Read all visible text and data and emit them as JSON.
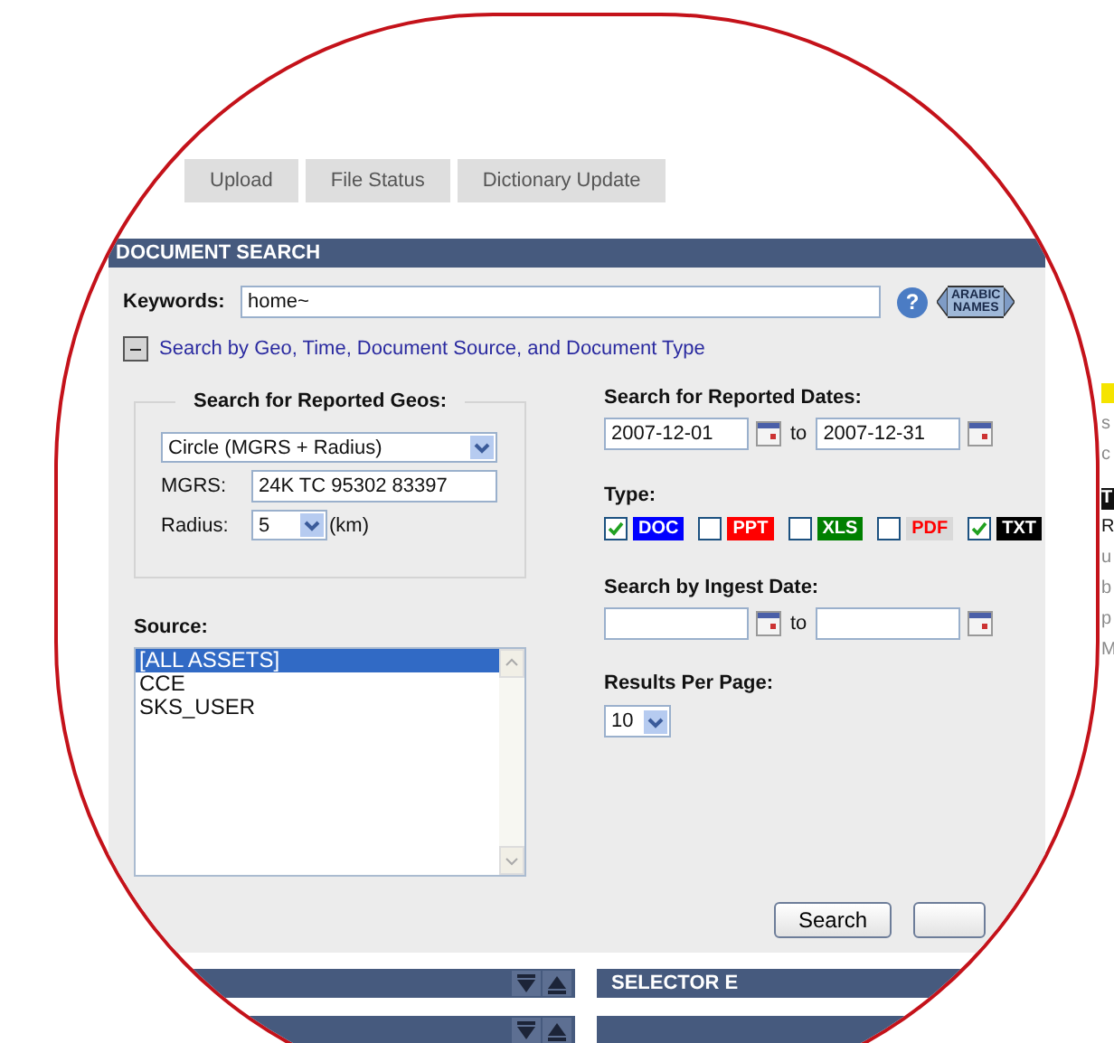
{
  "tabs": [
    {
      "label": "Upload"
    },
    {
      "label": "File Status"
    },
    {
      "label": "Dictionary Update"
    }
  ],
  "section_title": "DOCUMENT SEARCH",
  "keywords": {
    "label": "Keywords:",
    "value": "home~",
    "help_symbol": "?"
  },
  "arabic_names_button": {
    "line_1": "ARABIC",
    "line_2": "NAMES"
  },
  "criteria_toggle": {
    "expanded": true,
    "link": "Search by Geo, Time, Document Source, and Document Type"
  },
  "geo": {
    "legend": "Search for Reported Geos:",
    "shape": "Circle (MGRS + Radius)",
    "mgrs_label": "MGRS:",
    "mgrs": "24K TC 95302 83397",
    "radius_label": "Radius:",
    "radius": "5",
    "unit": "(km)"
  },
  "source": {
    "label": "Source:",
    "items": [
      {
        "label": "[ALL ASSETS]",
        "selected": true
      },
      {
        "label": "CCE",
        "selected": false
      },
      {
        "label": "SKS_USER",
        "selected": false
      }
    ]
  },
  "reported_dates": {
    "label": "Search for Reported Dates:",
    "from": "2007-12-01",
    "to_label": "to",
    "to": "2007-12-31"
  },
  "type": {
    "label": "Type:",
    "options": [
      {
        "label": "DOC",
        "checked": true,
        "kind": "solid",
        "color": "#0000ff"
      },
      {
        "label": "PPT",
        "checked": false,
        "kind": "solid",
        "color": "#ff0000"
      },
      {
        "label": "XLS",
        "checked": false,
        "kind": "solid",
        "color": "#008000"
      },
      {
        "label": "PDF",
        "checked": false,
        "kind": "light",
        "color": "#ff0000"
      },
      {
        "label": "TXT",
        "checked": true,
        "kind": "solid",
        "color": "#000000"
      }
    ]
  },
  "ingest_date": {
    "label": "Search by Ingest Date:",
    "to_label": "to"
  },
  "results_per_page": {
    "label": "Results Per Page:",
    "value": "10"
  },
  "search_button": "Search",
  "selectors": [
    {
      "kind": "collapsible"
    },
    {
      "kind": "titled",
      "title": "SELECTOR E"
    },
    {
      "kind": "collapsible"
    },
    {
      "kind": "titled"
    }
  ],
  "side_fragments": [
    {
      "kind": "highlight"
    },
    {
      "kind": "text",
      "text": "s"
    },
    {
      "kind": "text",
      "text": "c"
    },
    {
      "kind": "tag",
      "text": "T"
    },
    {
      "kind": "dark",
      "text": "R"
    },
    {
      "kind": "text",
      "text": "u"
    },
    {
      "kind": "text",
      "text": "b"
    },
    {
      "kind": "text",
      "text": "p"
    },
    {
      "kind": "text",
      "text": "M"
    }
  ]
}
